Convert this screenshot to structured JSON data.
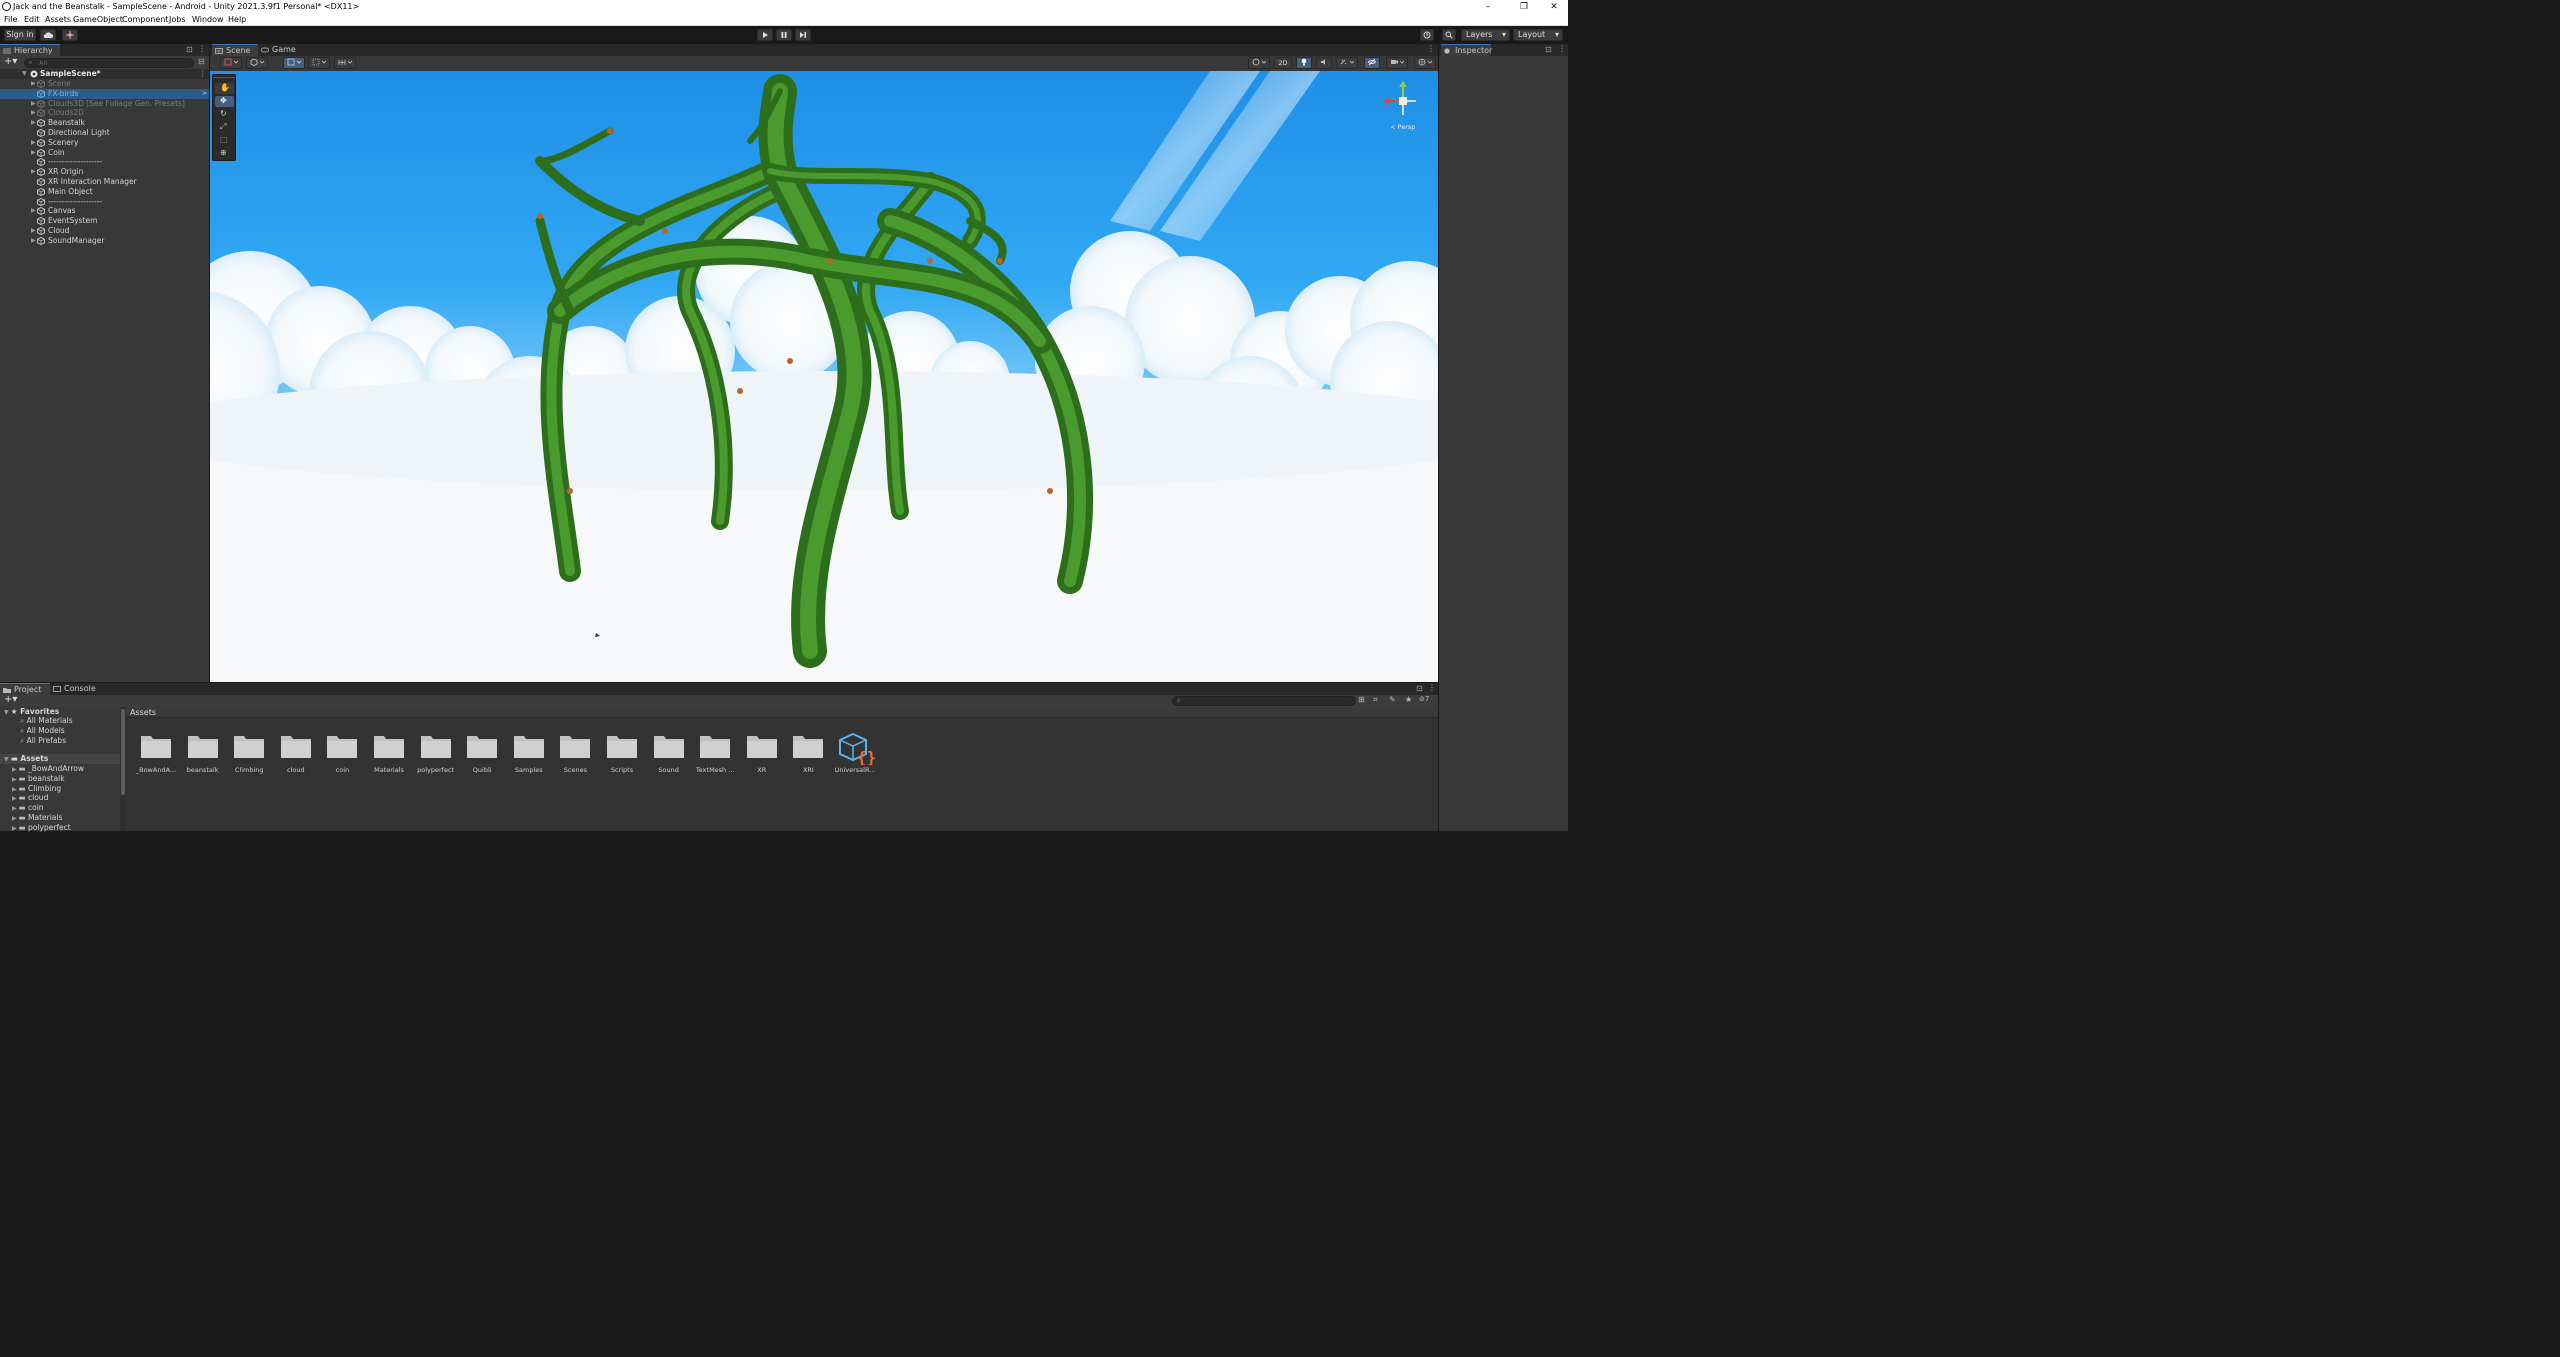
{
  "window": {
    "title": "Jack and the Beanstalk - SampleScene - Android - Unity 2021.3.9f1 Personal* <DX11>",
    "controls": [
      "–",
      "❐",
      "✕"
    ]
  },
  "menu": [
    "File",
    "Edit",
    "Assets",
    "GameObject",
    "Component",
    "Jobs",
    "Window",
    "Help"
  ],
  "toolbar": {
    "sign_in": "Sign in",
    "layers": "Layers",
    "layout": "Layout"
  },
  "hierarchy": {
    "tab": "Hierarchy",
    "search_placeholder": "All",
    "scene_name": "SampleScene*",
    "items": [
      {
        "label": "Scene",
        "dim": true,
        "arrow": true
      },
      {
        "label": "FX-birds",
        "selected": true,
        "blue": true
      },
      {
        "label": "Clouds3D [See Foliage Gen. Presets]",
        "dim": true,
        "arrow": true
      },
      {
        "label": "Clouds2D",
        "dim": true,
        "arrow": true
      },
      {
        "label": "Beanstalk",
        "arrow": true
      },
      {
        "label": "Directional Light"
      },
      {
        "label": "Scenery",
        "arrow": true
      },
      {
        "label": "Coin",
        "arrow": true
      },
      {
        "label": "--------------------"
      },
      {
        "label": "XR Origin",
        "arrow": true
      },
      {
        "label": "XR Interaction Manager"
      },
      {
        "label": "Main Object"
      },
      {
        "label": "--------------------"
      },
      {
        "label": "Canvas",
        "arrow": true
      },
      {
        "label": "EventSystem"
      },
      {
        "label": "Cloud",
        "arrow": true
      },
      {
        "label": "SoundManager",
        "arrow": true
      }
    ]
  },
  "scene": {
    "tabs": [
      "Scene",
      "Game"
    ],
    "mode_2d": "2D",
    "gizmo_label": "< Persp"
  },
  "inspector": {
    "tab": "Inspector"
  },
  "project": {
    "tabs": [
      "Project",
      "Console"
    ],
    "breadcrumb": "Assets",
    "hidden_count": "7",
    "favorites_label": "Favorites",
    "favorites": [
      "All Materials",
      "All Models",
      "All Prefabs"
    ],
    "assets_label": "Assets",
    "tree": [
      "_BowAndArrow",
      "beanstalk",
      "Climbing",
      "cloud",
      "coin",
      "Materials",
      "polyperfect"
    ],
    "folders": [
      "_BowAndA...",
      "beanstalk",
      "Climbing",
      "cloud",
      "coin",
      "Materials",
      "polyperfect",
      "Quibli",
      "Samples",
      "Scenes",
      "Scripts",
      "Sound",
      "TextMesh ...",
      "XR",
      "XRI",
      "UniversalR..."
    ]
  },
  "colors": {
    "accent": "#3a79bb",
    "selection": "#2c5d87",
    "panel": "#383838",
    "sky_top": "#1e8fe6",
    "beanstalk": "#2f7a1f"
  }
}
